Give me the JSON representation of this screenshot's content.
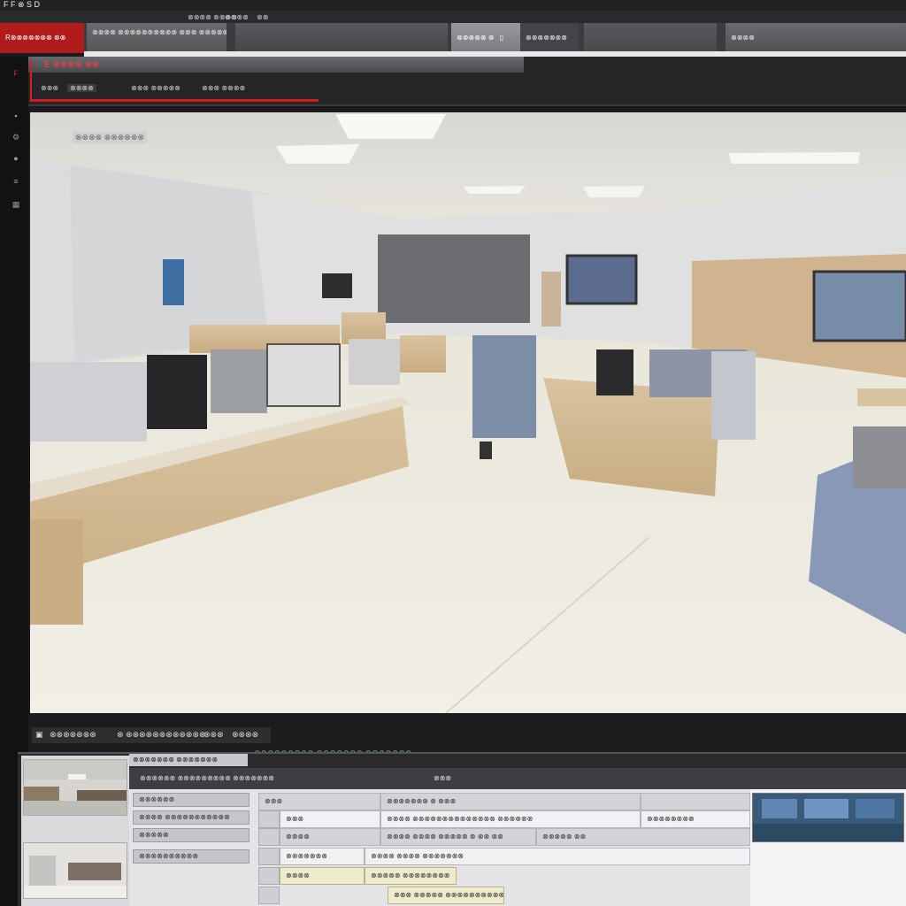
{
  "window": {
    "title": "F F ⊗ S D",
    "menu": [
      "⊗⊗⊗⊗ ⊗⊗⊗⊗",
      "⊗⊗⊗⊗",
      "⊗⊗"
    ]
  },
  "tabs": [
    {
      "label": "R⊗⊗⊗⊗⊗⊗⊗ ⊗⊗",
      "active": true
    },
    {
      "label": "⊗⊗⊗⊗ ⊗⊗⊗⊗⊗⊗⊗⊗⊗⊗ ⊗⊗⊗ ⊗⊗⊗⊗⊗⊗ ⊗⊗⊗⊗⊗⊗⊗⊗ ⊗⊗⊗⊗⊗⊗⊗⊗",
      "active": false
    },
    {
      "label": "",
      "active": false
    },
    {
      "label": "⊗⊗⊗⊗⊗ ⊗",
      "active": false
    },
    {
      "label": "⊗⊗⊗⊗⊗⊗⊗",
      "active": false
    },
    {
      "label": "",
      "active": false
    },
    {
      "label": "⊗⊗⊗⊗",
      "active": false
    }
  ],
  "panel": {
    "title": "E ⊗⊗⊗⊗ ⊗⊗",
    "tools": [
      "⊗⊗⊗",
      "⊗⊗⊗⊗",
      "⊗⊗⊗ ⊗⊗⊗⊗⊗",
      "⊗⊗⊗ ⊗⊗⊗⊗"
    ]
  },
  "viewport": {
    "overlay_label": "⊗⊗⊗⊗ ⊗⊗⊗⊗⊗⊗",
    "scene": "office-camera-feed"
  },
  "status": {
    "left_a": "⊗⊗⊗⊗⊗⊗⊗",
    "left_b": "⊗ ⊗⊗⊗⊗⊗⊗⊗⊗⊗⊗⊗⊗",
    "left_c": "⊗⊗⊗",
    "left_d": "⊗⊗⊗⊗",
    "green": "⊗⊗⊗⊗⊗⊗⊗⊗⊗ ⊗⊗⊗⊗⊗⊗⊗ ⊗⊗⊗⊗⊗⊗⊗"
  },
  "bottom": {
    "tab_label": "⊗⊗⊗⊗⊗⊗⊗ ⊗⊗⊗⊗⊗⊗⊗",
    "header": [
      "⊗⊗⊗⊗⊗⊗ ⊗⊗⊗⊗⊗⊗⊗⊗⊗ ⊗⊗⊗⊗⊗⊗⊗",
      "⊗⊗⊗"
    ],
    "side_items": [
      "⊗⊗⊗⊗⊗⊗",
      "⊗⊗⊗⊗ ⊗⊗⊗⊗⊗⊗⊗⊗⊗⊗⊗",
      "⊗⊗⊗⊗⊗",
      "⊗⊗⊗⊗⊗⊗⊗⊗⊗⊗"
    ],
    "grid": {
      "r0": [
        "⊗⊗⊗",
        "⊗⊗⊗⊗⊗⊗⊗ ⊗ ⊗⊗⊗",
        ""
      ],
      "r1": [
        "⊗⊗⊗",
        "⊗⊗⊗⊗ ⊗⊗⊗⊗⊗⊗⊗⊗⊗⊗⊗⊗⊗⊗ ⊗⊗⊗⊗⊗⊗",
        "⊗⊗⊗⊗⊗⊗⊗⊗"
      ],
      "r2": [
        "⊗⊗⊗⊗",
        "⊗⊗⊗⊗ ⊗⊗⊗⊗ ⊗⊗⊗⊗⊗ ⊗ ⊗⊗ ⊗⊗",
        "⊗⊗⊗⊗⊗ ⊗⊗"
      ],
      "r3": [
        "⊗⊗⊗⊗⊗⊗⊗",
        "⊗⊗⊗⊗ ⊗⊗⊗⊗ ⊗⊗⊗⊗⊗⊗⊗"
      ],
      "r4": [
        "⊗⊗⊗⊗",
        "⊗⊗⊗⊗⊗ ⊗⊗⊗⊗⊗⊗⊗⊗"
      ],
      "r5": [
        "⊗⊗⊗ ⊗⊗⊗⊗⊗ ⊗⊗⊗⊗⊗⊗⊗⊗⊗⊗⊗⊗"
      ]
    }
  },
  "colors": {
    "accent": "#d41e1e",
    "active_tab": "#b01c1c",
    "status_green": "#7bc08a"
  }
}
